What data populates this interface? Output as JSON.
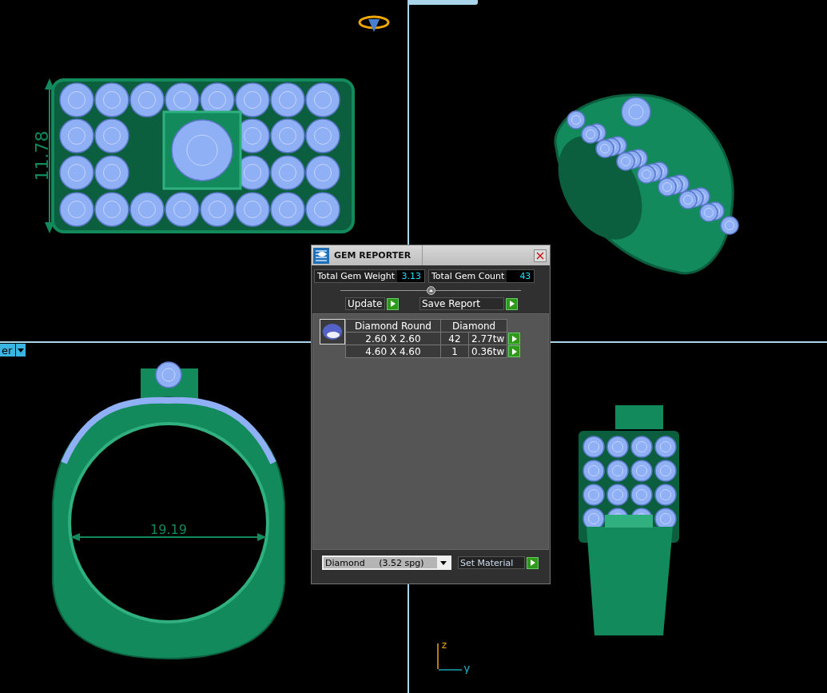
{
  "top_left_view": {
    "dimension": "11.78"
  },
  "bottom_left_view": {
    "view_menu": "er",
    "dimension": "19.19"
  },
  "bottom_right_view": {
    "axis_labels": [
      "z",
      "y"
    ]
  },
  "gem_reporter": {
    "title": "GEM REPORTER",
    "total_weight_label": "Total Gem Weight",
    "total_weight": "3.13",
    "total_count_label": "Total Gem Count",
    "total_count": "43",
    "buttons": [
      "Update",
      "Save Report"
    ],
    "table": {
      "columns": [
        "Diamond Round",
        "Diamond"
      ],
      "rows": [
        {
          "size": "2.60 X 2.60",
          "count": "42",
          "weight": "2.77tw"
        },
        {
          "size": "4.60 X 4.60",
          "count": "1",
          "weight": "0.36tw"
        }
      ]
    },
    "material": "Diamond     (3.52 spg)",
    "set_material": "Set Material"
  }
}
